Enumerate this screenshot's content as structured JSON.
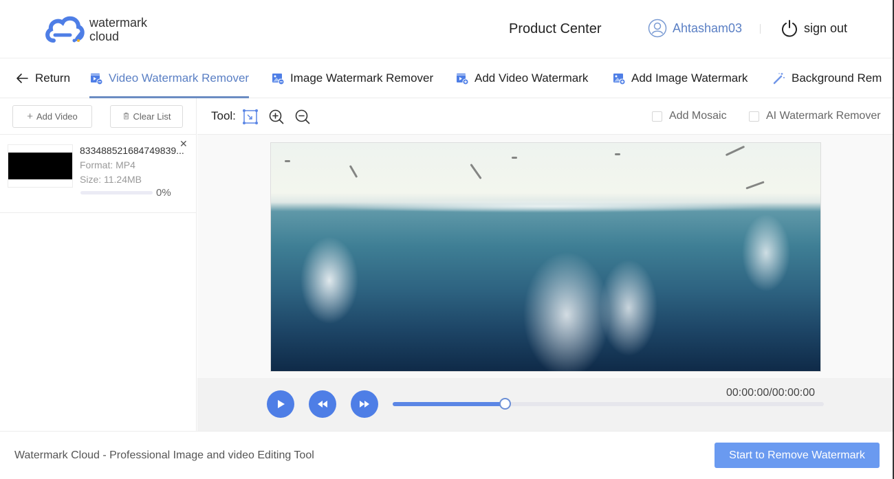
{
  "header": {
    "logo": {
      "line1": "watermark",
      "line2": "cloud"
    },
    "product_center": "Product Center",
    "username": "Ahtasham03",
    "sign_out": "sign out"
  },
  "nav": {
    "return_label": "Return",
    "tabs": [
      {
        "label": "Video Watermark Remover",
        "icon": "video-edit-icon",
        "active": true
      },
      {
        "label": "Image Watermark Remover",
        "icon": "image-edit-icon",
        "active": false
      },
      {
        "label": "Add Video Watermark",
        "icon": "video-add-icon",
        "active": false
      },
      {
        "label": "Add Image Watermark",
        "icon": "image-add-icon",
        "active": false
      },
      {
        "label": "Background Rem",
        "icon": "magic-wand-icon",
        "active": false
      }
    ]
  },
  "sidebar": {
    "add_video": "Add Video",
    "clear_list": "Clear List",
    "files": [
      {
        "name": "833488521684749839...",
        "format": "Format: MP4",
        "size": "Size: 11.24MB",
        "progress": 0,
        "progress_label": "0%"
      }
    ]
  },
  "toolbar": {
    "tool_label": "Tool:",
    "tools": [
      "select-rect-icon",
      "zoom-in-icon",
      "zoom-out-icon"
    ],
    "add_mosaic": {
      "label": "Add Mosaic",
      "checked": false
    },
    "ai_remover": {
      "label": "AI Watermark Remover",
      "checked": false
    }
  },
  "player": {
    "timecode": "00:00:00/00:00:00",
    "slider_value": 0.26
  },
  "footer": {
    "tagline": "Watermark Cloud - Professional Image and video Editing Tool",
    "start_button": "Start to Remove Watermark"
  },
  "colors": {
    "accent": "#4e7ee6",
    "active_tab": "#5a7fc4",
    "start_button": "#6a9af0"
  }
}
